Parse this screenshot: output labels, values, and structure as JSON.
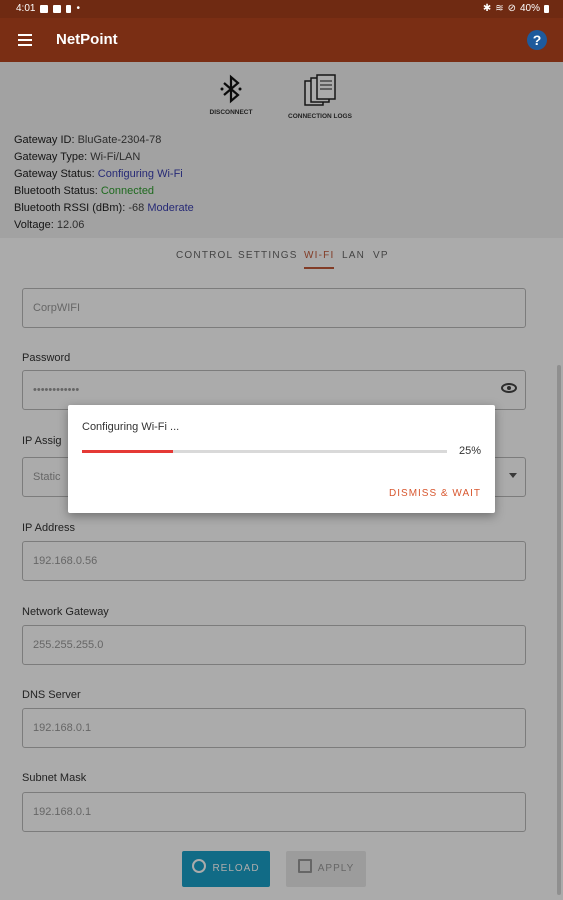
{
  "status_bar": {
    "time": "4:01",
    "battery": "40%"
  },
  "app_bar": {
    "title": "NetPoint",
    "help_icon": "?"
  },
  "actions": {
    "disconnect_label": "DISCONNECT",
    "logs_label": "CONNECTION LOGS"
  },
  "gateway_info": {
    "id_label": "Gateway ID:",
    "id_value": "BluGate-2304-78",
    "type_label": "Gateway Type:",
    "type_value": "Wi-Fi/LAN",
    "status_label": "Gateway Status:",
    "status_value": "Configuring Wi-Fi",
    "bt_status_label": "Bluetooth Status:",
    "bt_status_value": "Connected",
    "rssi_label": "Bluetooth RSSI (dBm):",
    "rssi_value": "-68",
    "rssi_quality": "Moderate",
    "voltage_label": "Voltage:",
    "voltage_value": "12.06"
  },
  "tabs": [
    "CONTROL",
    "SETTINGS",
    "WI-FI",
    "LAN",
    "VP"
  ],
  "active_tab": "WI-FI",
  "form": {
    "ssid_value": "CorpWIFI",
    "password_label": "Password",
    "password_value": "••••••••••••",
    "ip_assign_label": "IP Assig",
    "ip_assign_value": "Static",
    "ip_address_label": "IP Address",
    "ip_address_value": "192.168.0.56",
    "gateway_label": "Network Gateway",
    "gateway_value": "255.255.255.0",
    "dns_label": "DNS Server",
    "dns_value": "192.168.0.1",
    "subnet_label": "Subnet Mask",
    "subnet_value": "192.168.0.1",
    "reload_label": "RELOAD",
    "apply_label": "APPLY"
  },
  "dialog": {
    "message": "Configuring Wi-Fi ...",
    "progress": 0.25,
    "progress_text": "25%",
    "dismiss_label": "DISMISS & WAIT"
  },
  "colors": {
    "app_bar": "#7a2e14",
    "accent": "#d8572f",
    "progress": "#e53935",
    "reload": "#1aa0c8"
  }
}
